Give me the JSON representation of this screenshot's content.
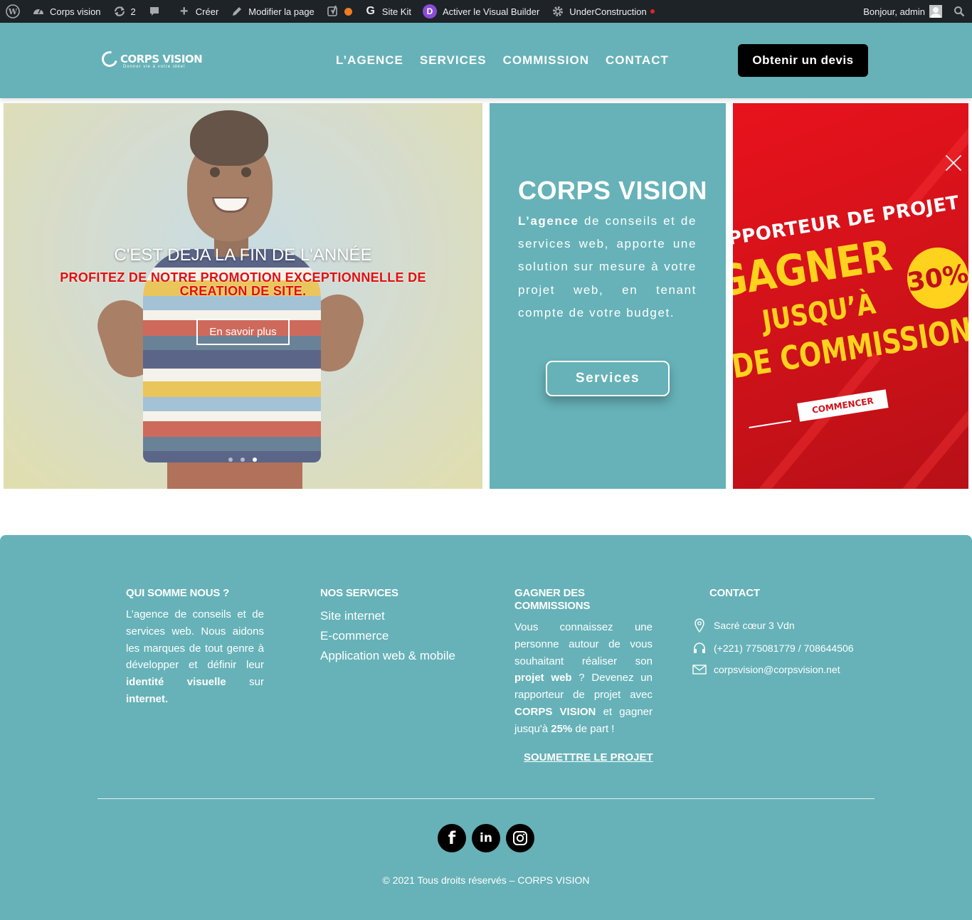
{
  "adminbar": {
    "site_name": "Corps vision",
    "updates_count": "2",
    "create_label": "Créer",
    "edit_label": "Modifier la page",
    "sitekit_label": "Site Kit",
    "visual_builder_label": "Activer le Visual Builder",
    "underconstruction_label": "UnderConstruction",
    "greeting": "Bonjour, admin"
  },
  "header": {
    "logo_text": "CORPS VISION",
    "logo_tagline": "Donner vie à votre idée!",
    "nav": [
      "L’AGENCE",
      "SERVICES",
      "COMMISSION",
      "CONTACT"
    ],
    "cta_label": "Obtenir un devis"
  },
  "slider": {
    "title": "C'EST DEJA LA FIN DE L'ANNÉE",
    "subtitle": "PROFITEZ DE NOTRE PROMOTION EXCEPTIONNELLE DE CREATION DE SITE.",
    "button_label": "En savoir plus",
    "dot_count": 3,
    "active_dot": 3
  },
  "about": {
    "title": "CORPS VISION",
    "lead_bold": "L’agence",
    "text": " de conseils et de services web, apporte une solution sur mesure à votre projet web, en tenant compte de votre budget.",
    "button_label": "Services"
  },
  "promo": {
    "line1": "APPORTEUR DE PROJET",
    "line2": "GAGNER",
    "line3": "JUSQU’À",
    "badge": "30%",
    "line4": "DE COMMISSION",
    "button_label": "COMMENCER"
  },
  "footer": {
    "about": {
      "heading": "QUI SOMME NOUS ?",
      "text_1": "L’agence de conseils et de services web. Nous aidons les marques de tout genre à développer et définir leur ",
      "bold_1": "identité visuelle",
      "text_2": " sur ",
      "bold_2": "internet."
    },
    "services": {
      "heading": "NOS SERVICES",
      "items": [
        "Site internet",
        "E-commerce",
        "Application web & mobile"
      ]
    },
    "commission": {
      "heading": "GAGNER DES COMMISSIONS",
      "text_1": "Vous connaissez une personne autour de vous souhaitant réaliser son ",
      "bold_1": "projet web",
      "text_2": " ? Devenez un rapporteur de projet avec ",
      "bold_2": "CORPS VISION",
      "text_3": " et gagner jusqu'à ",
      "bold_3": "25%",
      "text_4": " de part !",
      "link_label": "SOUMETTRE LE PROJET"
    },
    "contact": {
      "heading": "CONTACT",
      "address": "Sacré cœur 3 Vdn",
      "phone": "(+221) 775081779 / 708644506",
      "email": "corpsvision@corpsvision.net"
    },
    "copyright": "© 2021 Tous droits réservés – CORPS VISION"
  }
}
